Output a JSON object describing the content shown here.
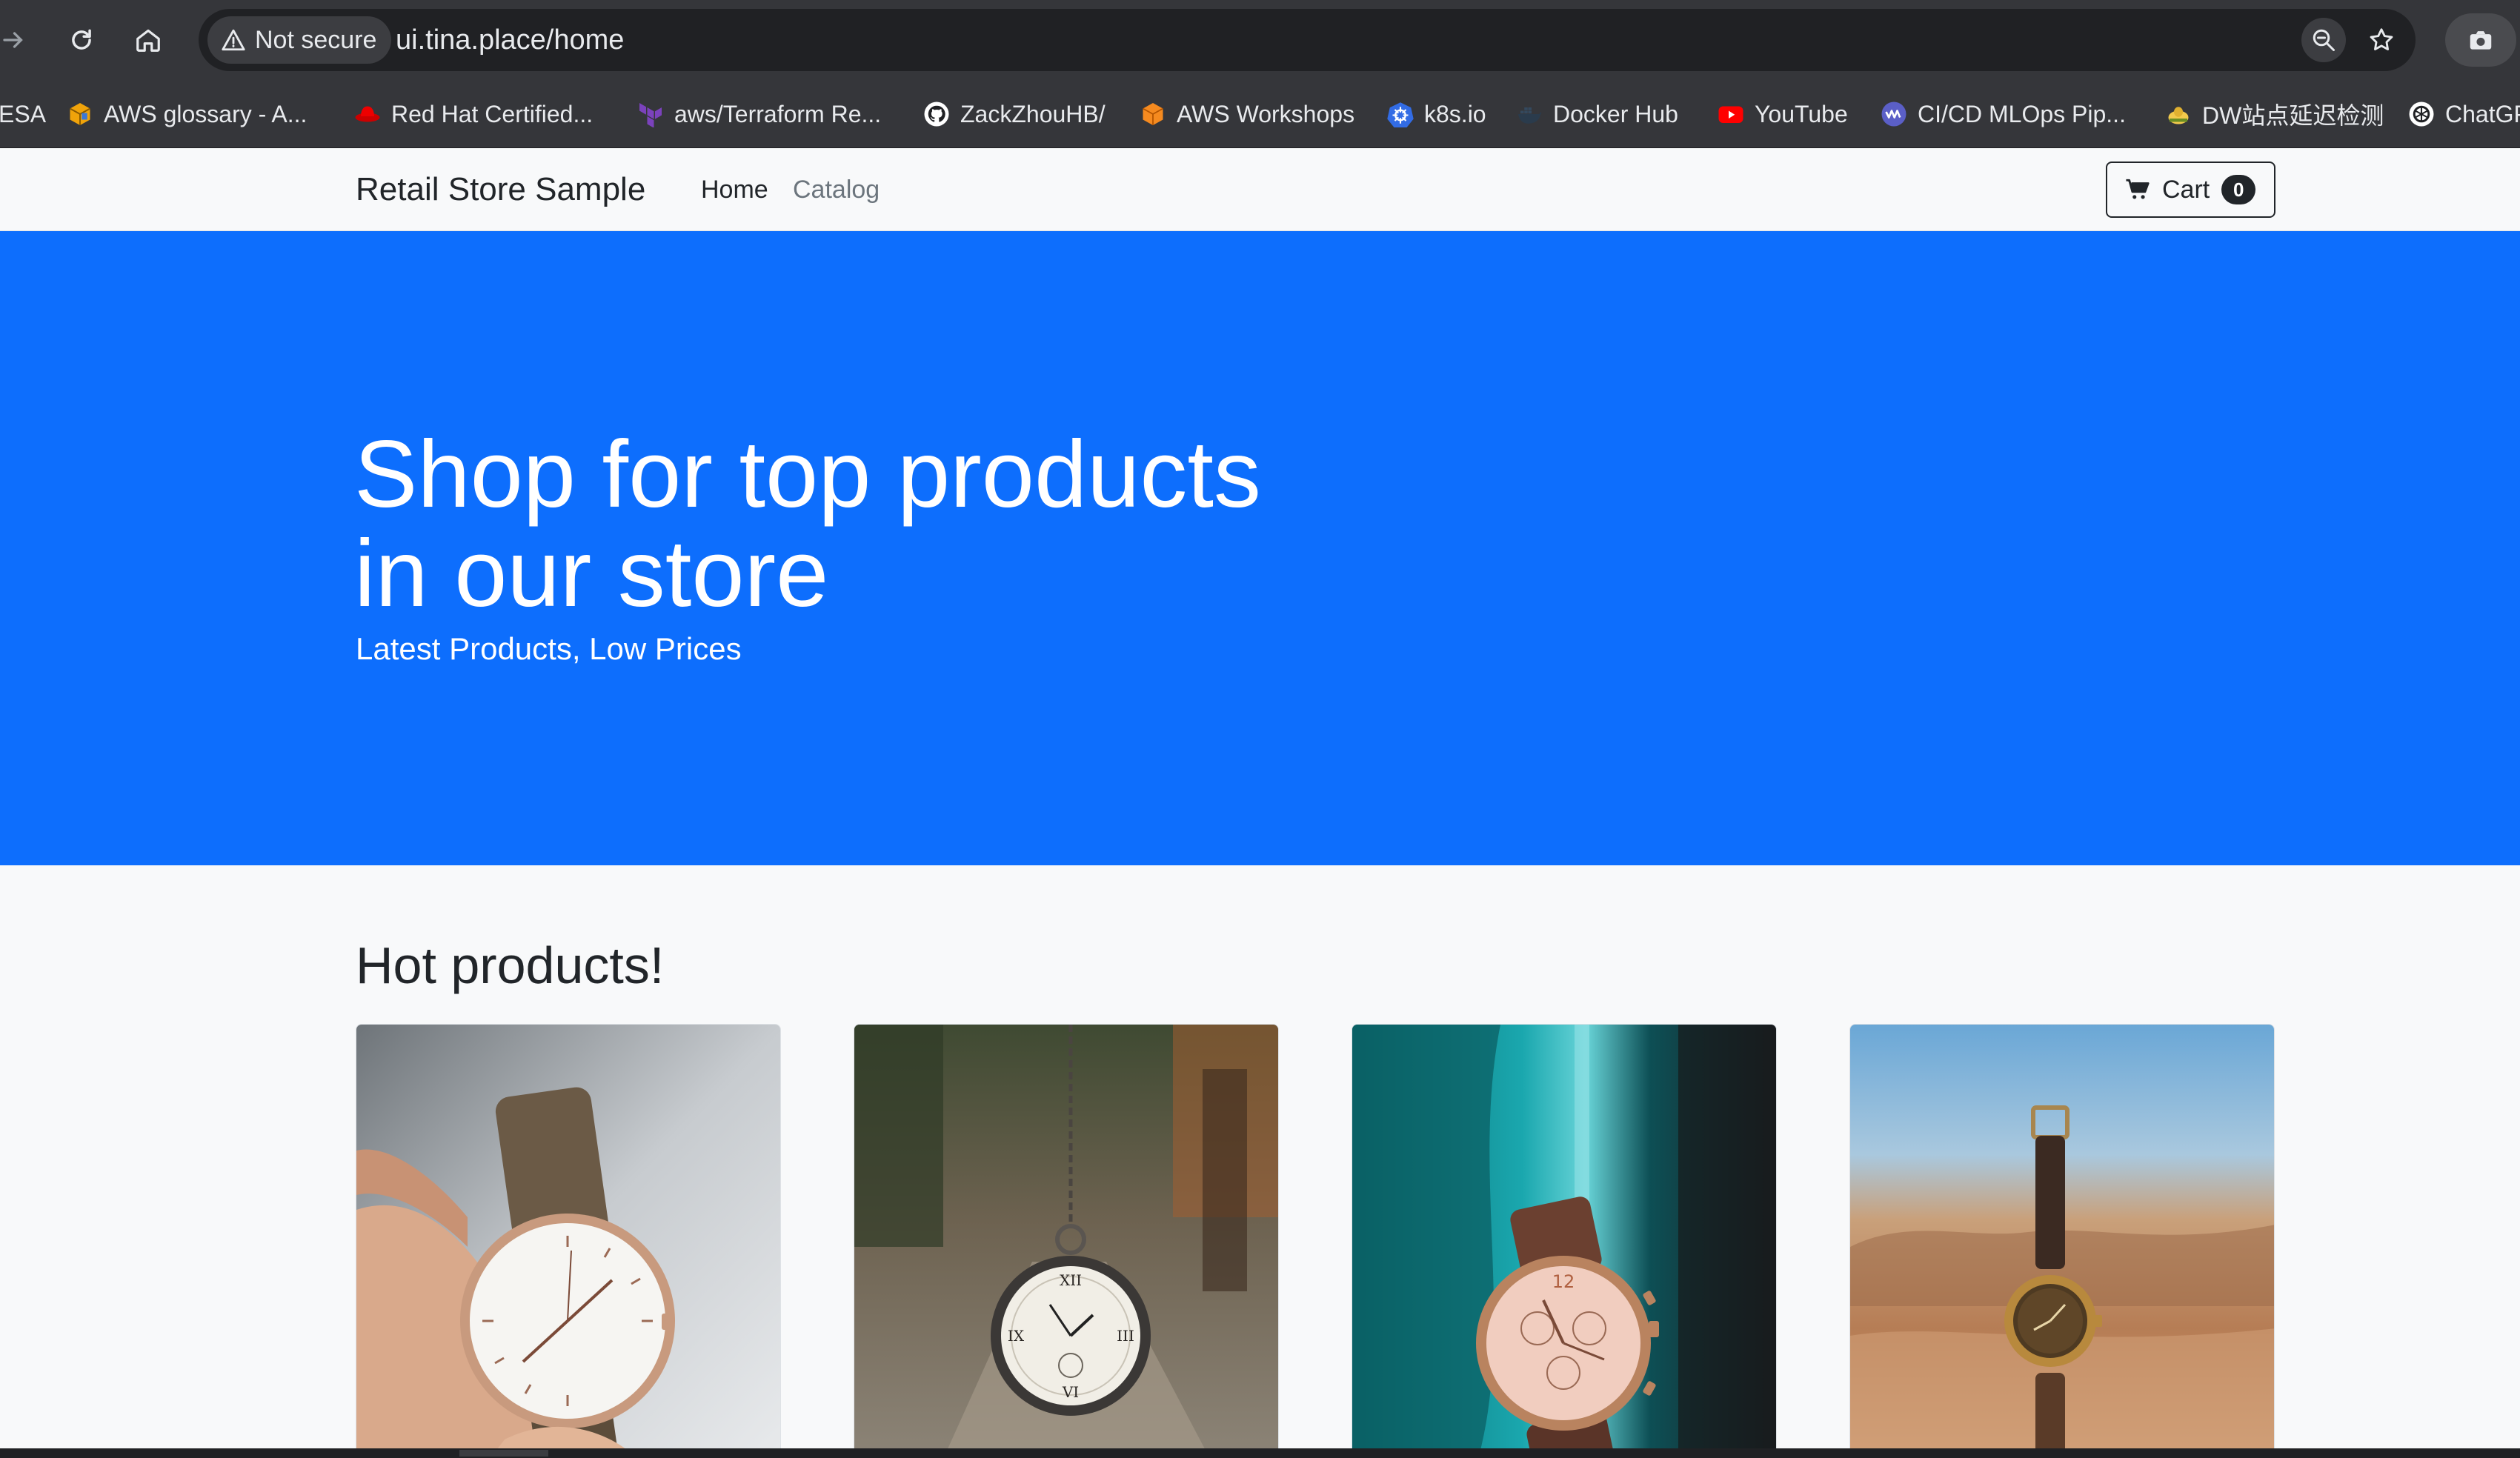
{
  "browser": {
    "security_label": "Not secure",
    "url": "ui.tina.place/home",
    "bookmarks": [
      {
        "label": "ESA",
        "icon": "none"
      },
      {
        "label": "AWS glossary - A...",
        "icon": "aws-cube-icon"
      },
      {
        "label": "Red Hat Certified...",
        "icon": "redhat-icon"
      },
      {
        "label": "aws/Terraform Re...",
        "icon": "terraform-icon"
      },
      {
        "label": "ZackZhouHB/",
        "icon": "github-icon"
      },
      {
        "label": "AWS Workshops",
        "icon": "aws-workshops-icon"
      },
      {
        "label": "k8s.io",
        "icon": "kubernetes-icon"
      },
      {
        "label": "Docker Hub",
        "icon": "docker-icon"
      },
      {
        "label": "YouTube",
        "icon": "youtube-icon"
      },
      {
        "label": "CI/CD MLOps Pip...",
        "icon": "mlops-icon"
      },
      {
        "label": "DW站点延迟检测",
        "icon": "dw-icon"
      },
      {
        "label": "ChatGP",
        "icon": "chatgpt-icon"
      }
    ]
  },
  "navbar": {
    "brand": "Retail Store Sample",
    "links": [
      {
        "label": "Home",
        "active": true
      },
      {
        "label": "Catalog",
        "active": false
      }
    ],
    "cart_label": "Cart",
    "cart_count": "0"
  },
  "hero": {
    "title_line1": "Shop for top products",
    "title_line2": "in our store",
    "subtitle": "Latest Products, Low Prices",
    "background": "#0d6efd"
  },
  "hot_products": {
    "title": "Hot products!",
    "products": [
      {
        "image": "hand-holding-white-watch"
      },
      {
        "image": "hanging-pocket-watch"
      },
      {
        "image": "watch-on-teal-fabric"
      },
      {
        "image": "brown-strap-watch-desert"
      }
    ]
  }
}
